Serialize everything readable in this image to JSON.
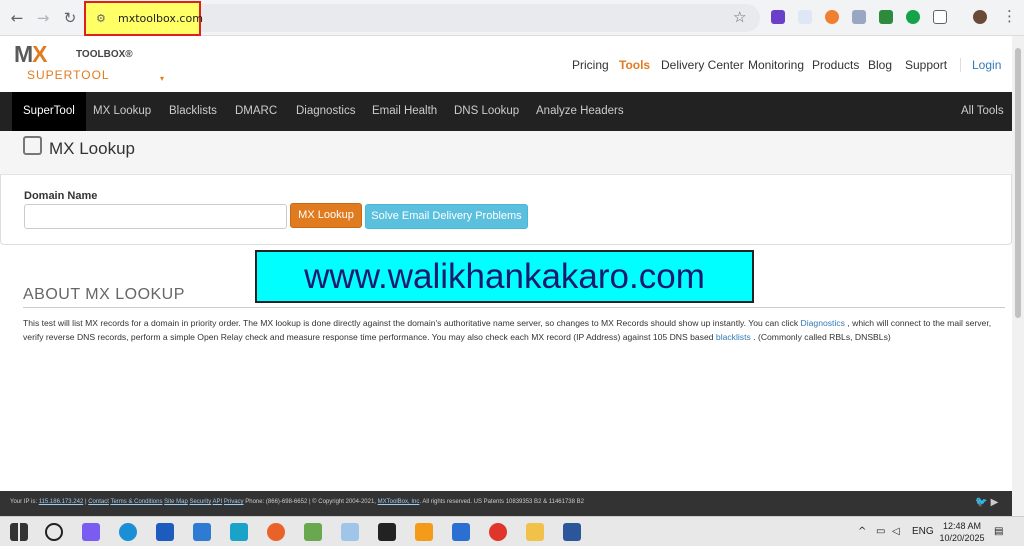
{
  "browser": {
    "url": "mxtoolbox.com",
    "back_icon": "←",
    "forward_icon": "→",
    "reload_icon": "↻",
    "tune_icon": "⚙",
    "star_icon": "☆",
    "menu_icon": "⋮"
  },
  "header": {
    "logo_mx": "M",
    "logo_x": "X",
    "logo_toolbox": "TOOLBOX®",
    "supertool": "SUPERTOOL",
    "caret": "▾",
    "nav": [
      "Pricing",
      "Tools",
      "Delivery Center",
      "Monitoring",
      "Products",
      "Blog",
      "Support"
    ],
    "login": "Login"
  },
  "dark_nav": {
    "items": [
      "SuperTool",
      "MX Lookup",
      "Blacklists",
      "DMARC",
      "Diagnostics",
      "Email Health",
      "DNS Lookup",
      "Analyze Headers"
    ],
    "right": "All Tools"
  },
  "main": {
    "title": "MX Lookup",
    "domain_label": "Domain Name",
    "domain_value": "",
    "lookup_button": "MX Lookup",
    "solve_button": "Solve Email Delivery Problems"
  },
  "watermark": "www.walikhankakaro.com",
  "about": {
    "title": "ABOUT MX LOOKUP",
    "text_1": "This test will list MX records for a domain in priority order. The MX lookup is done directly against the domain's authoritative name server, so changes to MX Records should show up instantly. You can click ",
    "link_1": "Diagnostics",
    "text_2": " , which will connect to the mail server, verify reverse DNS records, perform a simple Open Relay check and measure response time performance. You may also check each MX record (IP Address) against 105 DNS based ",
    "link_2": "blacklists",
    "text_3": " . (Commonly called RBLs, DNSBLs)"
  },
  "footer": {
    "ip_label": "Your IP is: ",
    "ip": "115.186.173.242",
    "sep": " | ",
    "links": [
      "Contact",
      "Terms & Conditions",
      "Site Map",
      "Security",
      "API",
      "Privacy"
    ],
    "phone": " Phone: (866)-698-6652 | © Copyright 2004-2021, ",
    "company": "MXToolBox, Inc",
    "rights": ". All rights reserved. US Patents 10839353 B2 & 11461738 B2",
    "social": "🐦 ▶"
  },
  "taskbar": {
    "tray_caret": "^",
    "lang": "ENG",
    "time": "12:48 AM",
    "date": "10/20/2025"
  },
  "colors": {
    "accent": "#e07b20",
    "info": "#5bc0de",
    "dark_nav": "#222222",
    "watermark_bg": "#00ffff"
  }
}
